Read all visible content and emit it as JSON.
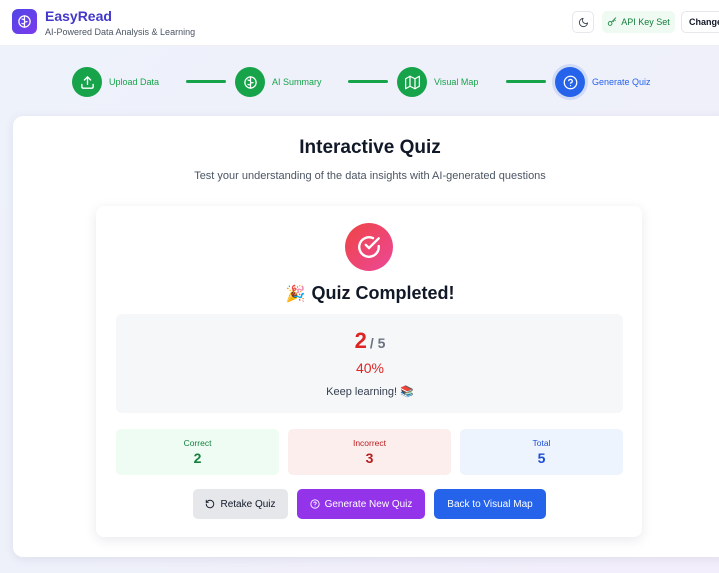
{
  "header": {
    "app_name": "EasyRead",
    "tagline": "AI-Powered Data Analysis & Learning",
    "api_status": "API Key Set",
    "change_label": "Change"
  },
  "steps": [
    {
      "label": "Upload Data",
      "icon": "upload-icon",
      "status": "done"
    },
    {
      "label": "AI Summary",
      "icon": "brain-icon",
      "status": "done"
    },
    {
      "label": "Visual Map",
      "icon": "map-icon",
      "status": "done"
    },
    {
      "label": "Generate Quiz",
      "icon": "question-circle-icon",
      "status": "active"
    }
  ],
  "quiz": {
    "title": "Interactive Quiz",
    "subtitle": "Test your understanding of the data insights with AI-generated questions",
    "completed_emoji": "🎉",
    "completed_title": "Quiz Completed!",
    "score": "2",
    "total_display": "/ 5",
    "percent": "40%",
    "message": "Keep learning! 📚",
    "stats": {
      "correct_label": "Correct",
      "correct_value": "2",
      "incorrect_label": "Incorrect",
      "incorrect_value": "3",
      "total_label": "Total",
      "total_value": "5"
    },
    "buttons": {
      "retake": "Retake Quiz",
      "new_quiz": "Generate New Quiz",
      "back": "Back to Visual Map"
    }
  },
  "colors": {
    "brand": "#4338ca",
    "step_done": "#16a34a",
    "step_active": "#2563eb",
    "score": "#dc2626"
  }
}
